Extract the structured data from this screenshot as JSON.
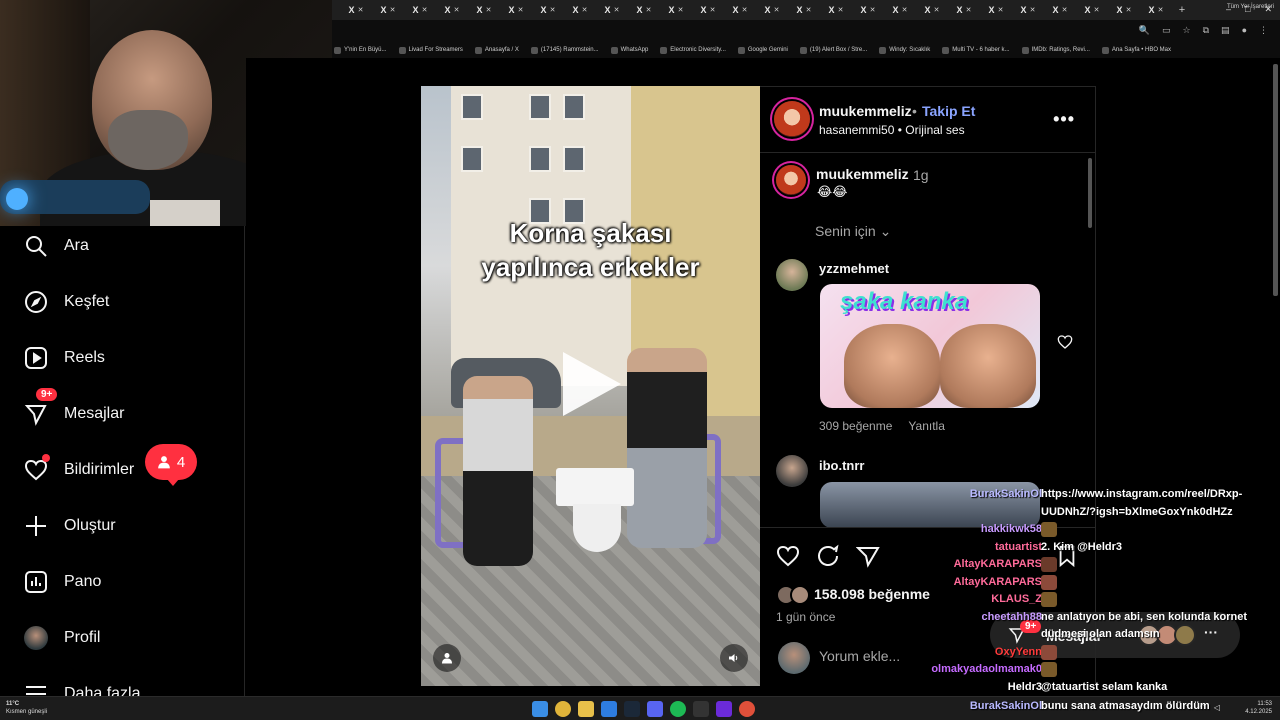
{
  "browser": {
    "tab_label": "X",
    "tab_count_visible": 26,
    "window_controls": [
      "–",
      "□",
      "✕"
    ],
    "bookmarks": [
      "Y'nin En Büyü...",
      "Livad For Streamers",
      "Anasayfa / X",
      "(17145) Rammstein...",
      "WhatsApp",
      "Electronic Diversity...",
      "Google Gemini",
      "(19) Alert Box / Stre...",
      "Windy: Sıcaklık",
      "Multi TV - 6 haber k...",
      "IMDb: Ratings, Revi...",
      "Ana Sayfa • HBO Max"
    ],
    "bookmarks_right": "Tüm Yer İşaretleri"
  },
  "sidebar": {
    "items": [
      {
        "label": "Ara",
        "icon": "search-icon"
      },
      {
        "label": "Keşfet",
        "icon": "compass-icon"
      },
      {
        "label": "Reels",
        "icon": "reels-icon"
      },
      {
        "label": "Mesajlar",
        "icon": "messenger-icon",
        "badge": "9+"
      },
      {
        "label": "Bildirimler",
        "icon": "heart-icon"
      },
      {
        "label": "Oluştur",
        "icon": "plus-icon"
      },
      {
        "label": "Pano",
        "icon": "dashboard-icon"
      },
      {
        "label": "Profil",
        "icon": "profile-avatar"
      },
      {
        "label": "Daha fazla",
        "icon": "menu-icon"
      }
    ],
    "notification_pill_count": "4"
  },
  "video": {
    "overlay_line1": "Korna şakası",
    "overlay_line2": "yapılınca erkekler"
  },
  "post": {
    "username": "muukemmeliz",
    "follow_label": "Takip Et",
    "separator": "•",
    "audio_line": "hasanemmi50 • Orijinal ses",
    "caption_user": "muukemmeliz",
    "caption_time": "1g",
    "caption_text": "😂😂",
    "for_you_label": "Senin için",
    "comments": [
      {
        "user": "yzzmehmet",
        "image_text": "şaka kanka",
        "likes": "309 beğenme",
        "reply": "Yanıtla"
      },
      {
        "user": "ibo.tnrr"
      }
    ],
    "likes_count": "158.098 beğenme",
    "time_ago": "1 gün önce",
    "comment_placeholder": "Yorum ekle..."
  },
  "chat": {
    "messages": [
      {
        "name": "BurakSakinOl",
        "text": "https://www.instagram.com/reel/DRxp-",
        "name_color": "#b9b9ff"
      },
      {
        "name": "",
        "text": "UUDNhZ/?igsh=bXlmeGoxYnk0dHZz",
        "name_color": "#b9b9ff"
      },
      {
        "name": "hakkikwk58",
        "text": "",
        "emote": true,
        "name_color": "#c89bff"
      },
      {
        "name": "tatuartist",
        "text": "2. Kim @Heldr3",
        "name_color": "#ff6b9a"
      },
      {
        "name": "AltayKARAPARS",
        "text": "",
        "emote": true,
        "name_color": "#ff6b9a"
      },
      {
        "name": "AltayKARAPARS",
        "text": "",
        "emote": true,
        "name_color": "#ff6b9a"
      },
      {
        "name": "KLAUS_Z",
        "text": "",
        "emote": true,
        "name_color": "#ff6b9a"
      },
      {
        "name": "cheetahh88",
        "text": "ne anlatıyon be abi, sen kolunda kornet",
        "name_color": "#c89bff"
      },
      {
        "name": "",
        "text": "düdmesi olan adamsın",
        "name_color": "#c89bff"
      },
      {
        "name": "OxyYenn",
        "text": "",
        "emote": true,
        "name_color": "#ff3b3b"
      },
      {
        "name": "olmakyadaolmamak0",
        "text": "",
        "emote": true,
        "name_color": "#c56bff"
      },
      {
        "name": "Heldr3",
        "text": "@tatuartist selam kanka",
        "name_color": "#ffffff"
      }
    ],
    "bottom": {
      "name": "BurakSakinOl",
      "text": "bunu sana atmasaydım ölürdüm",
      "name_color": "#b9b9ff"
    }
  },
  "messages_dock": {
    "label": "Mesajlar",
    "badge": "9+"
  },
  "taskbar": {
    "weather_temp": "11°C",
    "weather_desc": "Kısmen güneşli",
    "time": "11:53",
    "date": "4.12.2025"
  }
}
